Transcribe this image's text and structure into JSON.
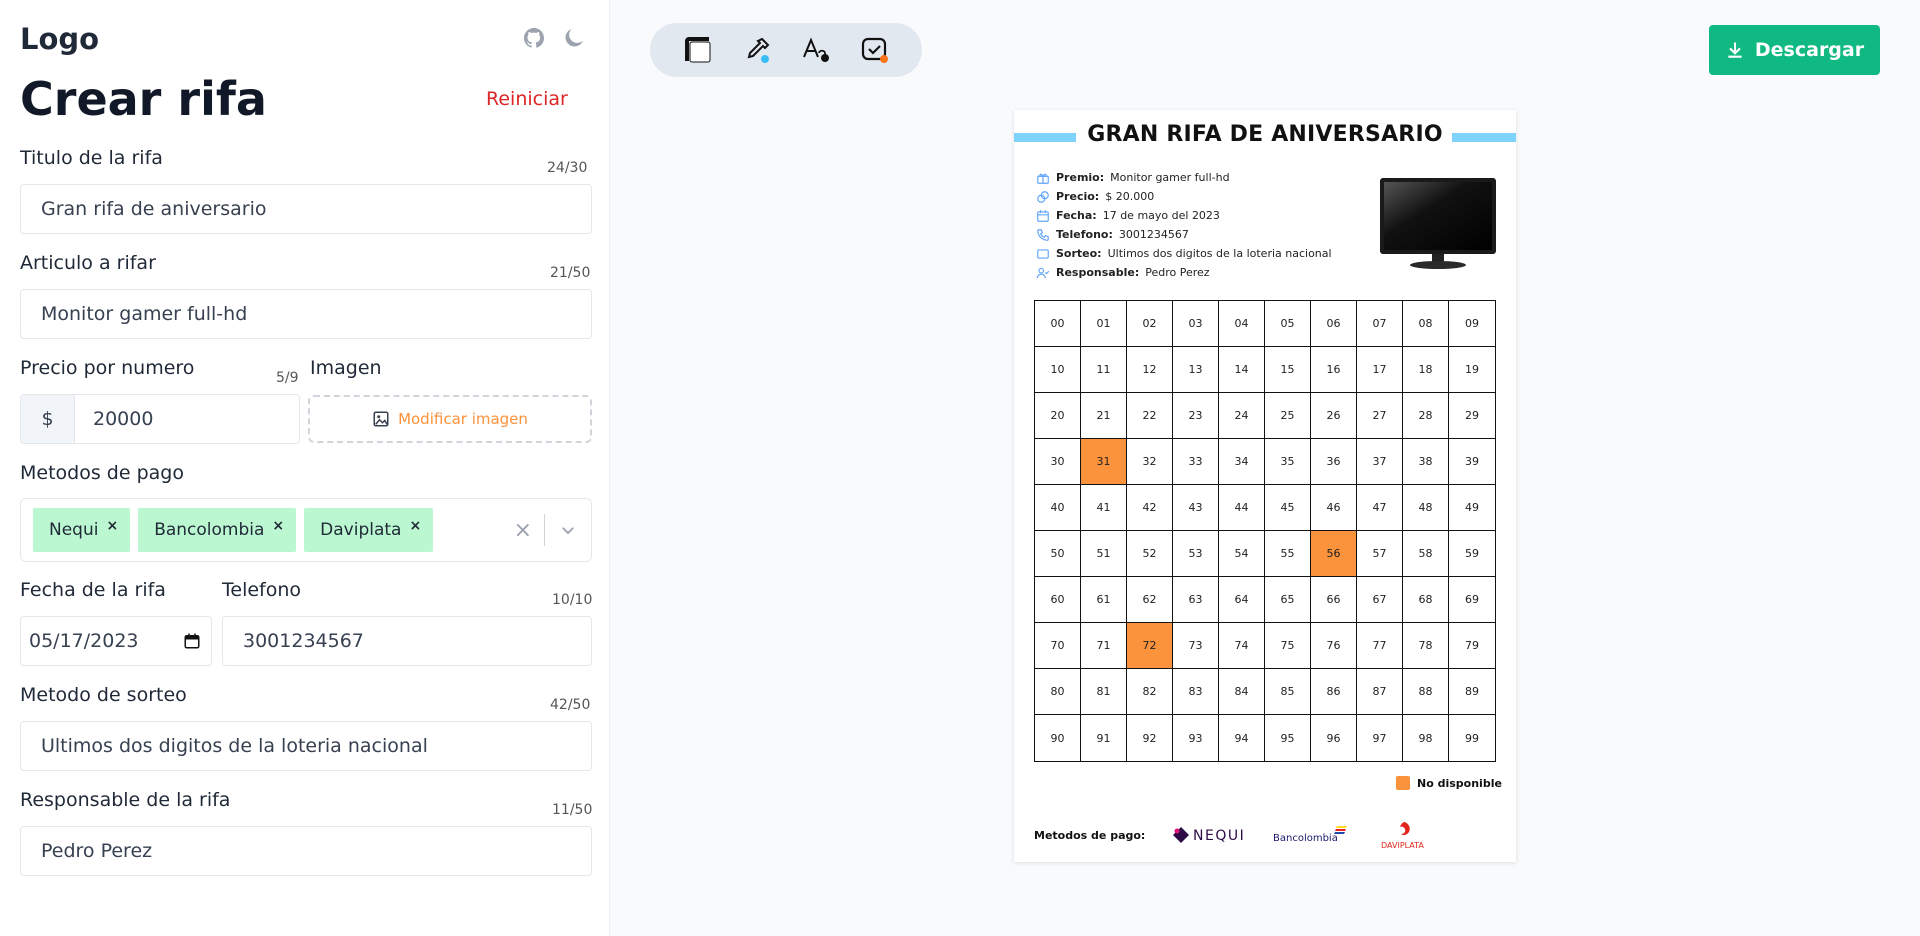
{
  "app": {
    "logo": "Logo"
  },
  "form": {
    "title": "Crear rifa",
    "reset_label": "Reiniciar",
    "raffle_title": {
      "label": "Titulo de la rifa",
      "counter": "24/30",
      "value": "Gran rifa de aniversario"
    },
    "article": {
      "label": "Articulo a rifar",
      "counter": "21/50",
      "value": "Monitor gamer full-hd"
    },
    "price": {
      "label": "Precio por numero",
      "counter": "5/9",
      "prefix": "$",
      "value": "20000"
    },
    "image": {
      "label": "Imagen",
      "button_label": "Modificar imagen"
    },
    "payment_methods": {
      "label": "Metodos de pago",
      "selected": [
        "Nequi",
        "Bancolombia",
        "Daviplata"
      ],
      "remove_symbol": "×",
      "clear_symbol": "×"
    },
    "date": {
      "label": "Fecha de la rifa",
      "value": "05/17/2023"
    },
    "phone": {
      "label": "Telefono",
      "counter": "10/10",
      "value": "3001234567"
    },
    "draw_method": {
      "label": "Metodo de sorteo",
      "counter": "42/50",
      "value": "Ultimos dos digitos de la loteria nacional"
    },
    "responsible": {
      "label": "Responsable de la rifa",
      "counter": "11/50",
      "value": "Pedro Perez"
    }
  },
  "toolbar": {
    "tools": [
      "layout-icon",
      "eyedropper-icon",
      "font-icon",
      "check-badge-icon"
    ],
    "download_label": "Descargar"
  },
  "card": {
    "title": "GRAN RIFA DE ANIVERSARIO",
    "details": [
      {
        "icon": "gift-icon",
        "label": "Premio:",
        "value": "Monitor gamer full-hd"
      },
      {
        "icon": "coins-icon",
        "label": "Precio:",
        "value": "$ 20.000"
      },
      {
        "icon": "calendar-icon",
        "label": "Fecha:",
        "value": "17 de mayo del 2023"
      },
      {
        "icon": "phone-icon",
        "label": "Telefono:",
        "value": "3001234567"
      },
      {
        "icon": "ticket-icon",
        "label": "Sorteo:",
        "value": "Ultimos dos digitos de la loteria nacional"
      },
      {
        "icon": "user-check-icon",
        "label": "Responsable:",
        "value": "Pedro Perez"
      }
    ],
    "numbers": [
      "00",
      "01",
      "02",
      "03",
      "04",
      "05",
      "06",
      "07",
      "08",
      "09",
      "10",
      "11",
      "12",
      "13",
      "14",
      "15",
      "16",
      "17",
      "18",
      "19",
      "20",
      "21",
      "22",
      "23",
      "24",
      "25",
      "26",
      "27",
      "28",
      "29",
      "30",
      "31",
      "32",
      "33",
      "34",
      "35",
      "36",
      "37",
      "38",
      "39",
      "40",
      "41",
      "42",
      "43",
      "44",
      "45",
      "46",
      "47",
      "48",
      "49",
      "50",
      "51",
      "52",
      "53",
      "54",
      "55",
      "56",
      "57",
      "58",
      "59",
      "60",
      "61",
      "62",
      "63",
      "64",
      "65",
      "66",
      "67",
      "68",
      "69",
      "70",
      "71",
      "72",
      "73",
      "74",
      "75",
      "76",
      "77",
      "78",
      "79",
      "80",
      "81",
      "82",
      "83",
      "84",
      "85",
      "86",
      "87",
      "88",
      "89",
      "90",
      "91",
      "92",
      "93",
      "94",
      "95",
      "96",
      "97",
      "98",
      "99"
    ],
    "unavailable": [
      "31",
      "56",
      "72"
    ],
    "legend_label": "No disponible",
    "payments_label": "Metodos de pago:",
    "payment_logos": [
      "NEQUI",
      "Bancolombia",
      "DAVIPLATA"
    ],
    "colors": {
      "accent_bar": "#7dd3fc",
      "unavailable": "#fb923c"
    }
  },
  "colors": {
    "primary": "#10b981",
    "danger": "#dc2626",
    "chip": "#bbf7d0"
  }
}
